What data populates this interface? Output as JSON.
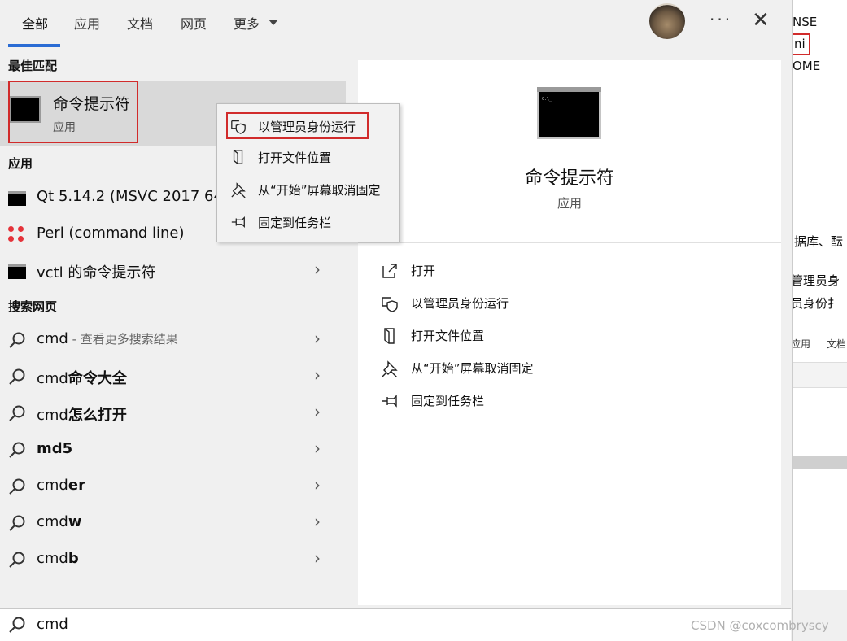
{
  "tabs": [
    {
      "label": "全部",
      "active": true
    },
    {
      "label": "应用",
      "active": false
    },
    {
      "label": "文档",
      "active": false
    },
    {
      "label": "网页",
      "active": false
    },
    {
      "label": "更多",
      "active": false
    }
  ],
  "sections": {
    "best_match": "最佳匹配",
    "apps": "应用",
    "web": "搜索网页"
  },
  "best_match": {
    "title": "命令提示符",
    "subtitle": "应用"
  },
  "apps": [
    {
      "label": "Qt 5.14.2 (MSVC 2017 64"
    },
    {
      "label": "Perl (command line)"
    },
    {
      "label": "vctl 的命令提示符"
    }
  ],
  "web": [
    {
      "prefix": "cmd",
      "bold": "",
      "hint": " - 查看更多搜索结果"
    },
    {
      "prefix": "cmd",
      "bold": "命令大全",
      "hint": ""
    },
    {
      "prefix": "cmd",
      "bold": "怎么打开",
      "hint": ""
    },
    {
      "prefix": "",
      "bold": "md5",
      "hint": ""
    },
    {
      "prefix": "cmd",
      "bold": "er",
      "hint": ""
    },
    {
      "prefix": "cmd",
      "bold": "w",
      "hint": ""
    },
    {
      "prefix": "cmd",
      "bold": "b",
      "hint": ""
    }
  ],
  "detail": {
    "title": "命令提示符",
    "subtitle": "应用",
    "actions": [
      {
        "label": "打开",
        "icon": "open-icon"
      },
      {
        "label": "以管理员身份运行",
        "icon": "shield-icon"
      },
      {
        "label": "打开文件位置",
        "icon": "folder-icon"
      },
      {
        "label": "从“开始”屏幕取消固定",
        "icon": "unpin-icon"
      },
      {
        "label": "固定到任务栏",
        "icon": "pin-icon"
      }
    ]
  },
  "context_menu": [
    {
      "label": "以管理员身份运行",
      "icon": "shield-icon"
    },
    {
      "label": "打开文件位置",
      "icon": "folder-icon"
    },
    {
      "label": "从“开始”屏幕取消固定",
      "icon": "unpin-icon"
    },
    {
      "label": "固定到任务栏",
      "icon": "pin-icon"
    }
  ],
  "search": {
    "value": "cmd"
  },
  "background_app": {
    "lines": [
      "NSE",
      "ni",
      "OME",
      "据库、酝",
      "管理员身",
      "员身份扌"
    ],
    "tabs": [
      "应用",
      "文档"
    ]
  },
  "watermark": "CSDN @coxcombryscy",
  "colors": {
    "accent": "#2b6cd4",
    "highlight_box": "#d12b2b",
    "selected_bg": "#d9d9d9"
  }
}
